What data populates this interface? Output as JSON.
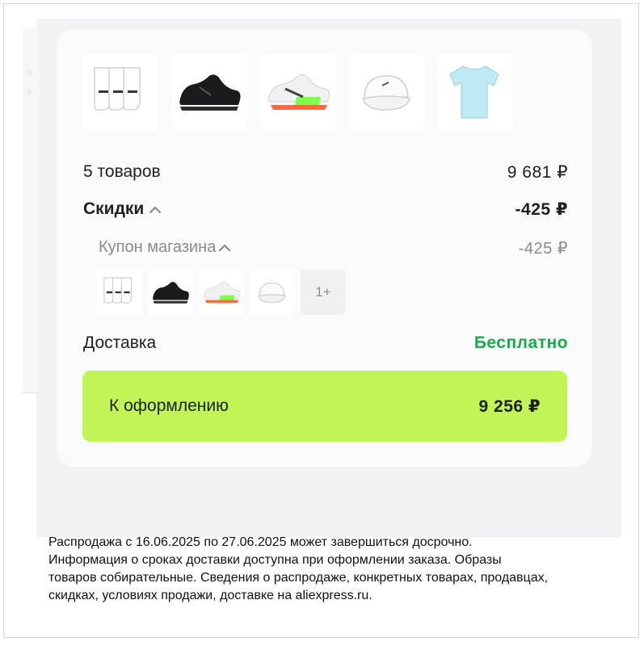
{
  "products": [
    {
      "name": "socks"
    },
    {
      "name": "black sneaker"
    },
    {
      "name": "white running shoe"
    },
    {
      "name": "white cap"
    },
    {
      "name": "light blue t-shirt"
    }
  ],
  "summary": {
    "items_label": "5 товаров",
    "items_value": "9 681 ₽",
    "discounts_label": "Скидки",
    "discounts_value": "-425 ₽",
    "coupon_label": "Купон магазина",
    "coupon_value": "-425 ₽",
    "coupon_more": "1+",
    "delivery_label": "Доставка",
    "delivery_value": "Бесплатно"
  },
  "checkout": {
    "label": "К оформлению",
    "total": "9 256 ₽"
  },
  "colors": {
    "accent_button": "#c1f557",
    "free_green": "#1aa94c",
    "muted_text": "#8a8a93"
  },
  "disclaimer": {
    "line1": "Распродажа с 16.06.2025 по 27.06.2025 может завершиться досрочно.",
    "line2": "Информация о сроках доставки доступна при оформлении заказа. Образы",
    "line3": "товаров собирательные. Сведения о распродаже, конкретных товарах, продавцах,",
    "line4": "скидках, условиях продажи, доставке на aliexpress.ru."
  }
}
